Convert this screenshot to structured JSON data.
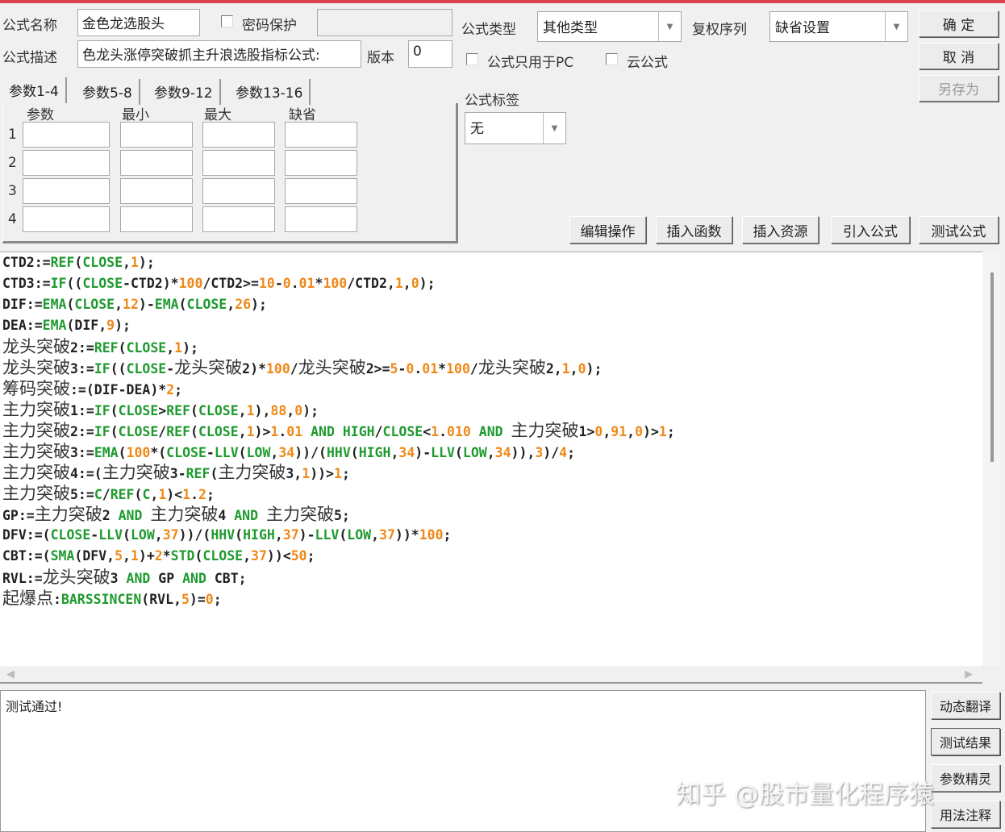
{
  "header": {
    "name_label": "公式名称",
    "name_value": "金色龙选股头",
    "password_label": "密码保护",
    "desc_label": "公式描述",
    "desc_value": "色龙头涨停突破抓主升浪选股指标公式:",
    "version_label": "版本",
    "version_value": "0",
    "type_label": "公式类型",
    "type_value": "其他类型",
    "adjust_label": "复权序列",
    "adjust_value": "缺省设置",
    "pc_only_label": "公式只用于PC",
    "cloud_label": "云公式",
    "tag_label": "公式标签",
    "tag_value": "无"
  },
  "buttons": {
    "ok": "确  定",
    "cancel": "取  消",
    "save_as": "另存为",
    "edit": "编辑操作",
    "insert_func": "插入函数",
    "insert_res": "插入资源",
    "import": "引入公式",
    "test": "测试公式"
  },
  "tabs": [
    "参数1-4",
    "参数5-8",
    "参数9-12",
    "参数13-16"
  ],
  "params": {
    "headers": [
      "参数",
      "最小",
      "最大",
      "缺省"
    ],
    "rows": [
      "1",
      "2",
      "3",
      "4"
    ]
  },
  "code": [
    [
      [
        "CTD2:=",
        "t"
      ],
      [
        "REF",
        "k"
      ],
      [
        "(",
        "t"
      ],
      [
        "CLOSE",
        "k"
      ],
      [
        ",",
        "t"
      ],
      [
        "1",
        "n"
      ],
      [
        ");",
        "t"
      ]
    ],
    [
      [
        "CTD3:=",
        "t"
      ],
      [
        "IF",
        "k"
      ],
      [
        "((",
        "t"
      ],
      [
        "CLOSE",
        "k"
      ],
      [
        "-CTD2)*",
        "t"
      ],
      [
        "100",
        "n"
      ],
      [
        "/CTD2>=",
        "t"
      ],
      [
        "10",
        "n"
      ],
      [
        "-",
        "t"
      ],
      [
        "0",
        "n"
      ],
      [
        ".",
        "t"
      ],
      [
        "01",
        "n"
      ],
      [
        "*",
        "t"
      ],
      [
        "100",
        "n"
      ],
      [
        "/CTD2,",
        "t"
      ],
      [
        "1",
        "n"
      ],
      [
        ",",
        "t"
      ],
      [
        "0",
        "n"
      ],
      [
        ");",
        "t"
      ]
    ],
    [
      [
        "DIF:=",
        "t"
      ],
      [
        "EMA",
        "k"
      ],
      [
        "(",
        "t"
      ],
      [
        "CLOSE",
        "k"
      ],
      [
        ",",
        "t"
      ],
      [
        "12",
        "n"
      ],
      [
        ")-",
        "t"
      ],
      [
        "EMA",
        "k"
      ],
      [
        "(",
        "t"
      ],
      [
        "CLOSE",
        "k"
      ],
      [
        ",",
        "t"
      ],
      [
        "26",
        "n"
      ],
      [
        ");",
        "t"
      ]
    ],
    [
      [
        "DEA:=",
        "t"
      ],
      [
        "EMA",
        "k"
      ],
      [
        "(DIF,",
        "t"
      ],
      [
        "9",
        "n"
      ],
      [
        ");",
        "t"
      ]
    ],
    [
      [
        "龙头突破",
        "c"
      ],
      [
        "2:=",
        "t"
      ],
      [
        "REF",
        "k"
      ],
      [
        "(",
        "t"
      ],
      [
        "CLOSE",
        "k"
      ],
      [
        ",",
        "t"
      ],
      [
        "1",
        "n"
      ],
      [
        ");",
        "t"
      ]
    ],
    [
      [
        "龙头突破",
        "c"
      ],
      [
        "3:=",
        "t"
      ],
      [
        "IF",
        "k"
      ],
      [
        "((",
        "t"
      ],
      [
        "CLOSE",
        "k"
      ],
      [
        "-",
        "t"
      ],
      [
        "龙头突破",
        "c"
      ],
      [
        "2)*",
        "t"
      ],
      [
        "100",
        "n"
      ],
      [
        "/",
        "t"
      ],
      [
        "龙头突破",
        "c"
      ],
      [
        "2>=",
        "t"
      ],
      [
        "5",
        "n"
      ],
      [
        "-",
        "t"
      ],
      [
        "0",
        "n"
      ],
      [
        ".",
        "t"
      ],
      [
        "01",
        "n"
      ],
      [
        "*",
        "t"
      ],
      [
        "100",
        "n"
      ],
      [
        "/",
        "t"
      ],
      [
        "龙头突破",
        "c"
      ],
      [
        "2,",
        "t"
      ],
      [
        "1",
        "n"
      ],
      [
        ",",
        "t"
      ],
      [
        "0",
        "n"
      ],
      [
        ");",
        "t"
      ]
    ],
    [
      [
        "筹码突破",
        "c"
      ],
      [
        ":=(DIF-DEA)*",
        "t"
      ],
      [
        "2",
        "n"
      ],
      [
        ";",
        "t"
      ]
    ],
    [
      [
        "主力突破",
        "c"
      ],
      [
        "1:=",
        "t"
      ],
      [
        "IF",
        "k"
      ],
      [
        "(",
        "t"
      ],
      [
        "CLOSE",
        "k"
      ],
      [
        ">",
        "t"
      ],
      [
        "REF",
        "k"
      ],
      [
        "(",
        "t"
      ],
      [
        "CLOSE",
        "k"
      ],
      [
        ",",
        "t"
      ],
      [
        "1",
        "n"
      ],
      [
        "),",
        "t"
      ],
      [
        "88",
        "n"
      ],
      [
        ",",
        "t"
      ],
      [
        "0",
        "n"
      ],
      [
        ");",
        "t"
      ]
    ],
    [
      [
        "主力突破",
        "c"
      ],
      [
        "2:=",
        "t"
      ],
      [
        "IF",
        "k"
      ],
      [
        "(",
        "t"
      ],
      [
        "CLOSE",
        "k"
      ],
      [
        "/",
        "t"
      ],
      [
        "REF",
        "k"
      ],
      [
        "(",
        "t"
      ],
      [
        "CLOSE",
        "k"
      ],
      [
        ",",
        "t"
      ],
      [
        "1",
        "n"
      ],
      [
        ")>",
        "t"
      ],
      [
        "1",
        "n"
      ],
      [
        ".",
        "t"
      ],
      [
        "01",
        "n"
      ],
      [
        " ",
        "t"
      ],
      [
        "AND",
        "k"
      ],
      [
        " ",
        "t"
      ],
      [
        "HIGH",
        "k"
      ],
      [
        "/",
        "t"
      ],
      [
        "CLOSE",
        "k"
      ],
      [
        "<",
        "t"
      ],
      [
        "1",
        "n"
      ],
      [
        ".",
        "t"
      ],
      [
        "010",
        "n"
      ],
      [
        " ",
        "t"
      ],
      [
        "AND",
        "k"
      ],
      [
        " ",
        "t"
      ],
      [
        "主力突破",
        "c"
      ],
      [
        "1>",
        "t"
      ],
      [
        "0",
        "n"
      ],
      [
        ",",
        "t"
      ],
      [
        "91",
        "n"
      ],
      [
        ",",
        "t"
      ],
      [
        "0",
        "n"
      ],
      [
        ")>",
        "t"
      ],
      [
        "1",
        "n"
      ],
      [
        ";",
        "t"
      ]
    ],
    [
      [
        "主力突破",
        "c"
      ],
      [
        "3:=",
        "t"
      ],
      [
        "EMA",
        "k"
      ],
      [
        "(",
        "t"
      ],
      [
        "100",
        "n"
      ],
      [
        "*(",
        "t"
      ],
      [
        "CLOSE",
        "k"
      ],
      [
        "-",
        "t"
      ],
      [
        "LLV",
        "k"
      ],
      [
        "(",
        "t"
      ],
      [
        "LOW",
        "k"
      ],
      [
        ",",
        "t"
      ],
      [
        "34",
        "n"
      ],
      [
        "))/(",
        "t"
      ],
      [
        "HHV",
        "k"
      ],
      [
        "(",
        "t"
      ],
      [
        "HIGH",
        "k"
      ],
      [
        ",",
        "t"
      ],
      [
        "34",
        "n"
      ],
      [
        ")-",
        "t"
      ],
      [
        "LLV",
        "k"
      ],
      [
        "(",
        "t"
      ],
      [
        "LOW",
        "k"
      ],
      [
        ",",
        "t"
      ],
      [
        "34",
        "n"
      ],
      [
        ")),",
        "t"
      ],
      [
        "3",
        "n"
      ],
      [
        ")/",
        "t"
      ],
      [
        "4",
        "n"
      ],
      [
        ";",
        "t"
      ]
    ],
    [
      [
        "主力突破",
        "c"
      ],
      [
        "4:=(",
        "t"
      ],
      [
        "主力突破",
        "c"
      ],
      [
        "3-",
        "t"
      ],
      [
        "REF",
        "k"
      ],
      [
        "(",
        "t"
      ],
      [
        "主力突破",
        "c"
      ],
      [
        "3,",
        "t"
      ],
      [
        "1",
        "n"
      ],
      [
        "))>",
        "t"
      ],
      [
        "1",
        "n"
      ],
      [
        ";",
        "t"
      ]
    ],
    [
      [
        "主力突破",
        "c"
      ],
      [
        "5:=",
        "t"
      ],
      [
        "C",
        "k"
      ],
      [
        "/",
        "t"
      ],
      [
        "REF",
        "k"
      ],
      [
        "(",
        "t"
      ],
      [
        "C",
        "k"
      ],
      [
        ",",
        "t"
      ],
      [
        "1",
        "n"
      ],
      [
        ")<",
        "t"
      ],
      [
        "1",
        "n"
      ],
      [
        ".",
        "t"
      ],
      [
        "2",
        "n"
      ],
      [
        ";",
        "t"
      ]
    ],
    [
      [
        "GP:=",
        "t"
      ],
      [
        "主力突破",
        "c"
      ],
      [
        "2 ",
        "t"
      ],
      [
        "AND",
        "k"
      ],
      [
        " ",
        "t"
      ],
      [
        "主力突破",
        "c"
      ],
      [
        "4 ",
        "t"
      ],
      [
        "AND",
        "k"
      ],
      [
        " ",
        "t"
      ],
      [
        "主力突破",
        "c"
      ],
      [
        "5;",
        "t"
      ]
    ],
    [
      [
        "DFV:=(",
        "t"
      ],
      [
        "CLOSE",
        "k"
      ],
      [
        "-",
        "t"
      ],
      [
        "LLV",
        "k"
      ],
      [
        "(",
        "t"
      ],
      [
        "LOW",
        "k"
      ],
      [
        ",",
        "t"
      ],
      [
        "37",
        "n"
      ],
      [
        "))/(",
        "t"
      ],
      [
        "HHV",
        "k"
      ],
      [
        "(",
        "t"
      ],
      [
        "HIGH",
        "k"
      ],
      [
        ",",
        "t"
      ],
      [
        "37",
        "n"
      ],
      [
        ")-",
        "t"
      ],
      [
        "LLV",
        "k"
      ],
      [
        "(",
        "t"
      ],
      [
        "LOW",
        "k"
      ],
      [
        ",",
        "t"
      ],
      [
        "37",
        "n"
      ],
      [
        "))*",
        "t"
      ],
      [
        "100",
        "n"
      ],
      [
        ";",
        "t"
      ]
    ],
    [
      [
        "CBT:=(",
        "t"
      ],
      [
        "SMA",
        "k"
      ],
      [
        "(DFV,",
        "t"
      ],
      [
        "5",
        "n"
      ],
      [
        ",",
        "t"
      ],
      [
        "1",
        "n"
      ],
      [
        ")+",
        "t"
      ],
      [
        "2",
        "n"
      ],
      [
        "*",
        "t"
      ],
      [
        "STD",
        "k"
      ],
      [
        "(",
        "t"
      ],
      [
        "CLOSE",
        "k"
      ],
      [
        ",",
        "t"
      ],
      [
        "37",
        "n"
      ],
      [
        "))<",
        "t"
      ],
      [
        "50",
        "n"
      ],
      [
        ";",
        "t"
      ]
    ],
    [
      [
        "RVL:=",
        "t"
      ],
      [
        "龙头突破",
        "c"
      ],
      [
        "3 ",
        "t"
      ],
      [
        "AND",
        "k"
      ],
      [
        " GP ",
        "t"
      ],
      [
        "AND",
        "k"
      ],
      [
        " CBT;",
        "t"
      ]
    ],
    [
      [
        "起爆点",
        "c"
      ],
      [
        ":",
        "t"
      ],
      [
        "BARSSINCEN",
        "k"
      ],
      [
        "(RVL,",
        "t"
      ],
      [
        "5",
        "n"
      ],
      [
        ")=",
        "t"
      ],
      [
        "0",
        "n"
      ],
      [
        ";",
        "t"
      ]
    ]
  ],
  "result_text": "测试通过!",
  "side_buttons": [
    "动态翻译",
    "测试结果",
    "参数精灵",
    "用法注释"
  ],
  "watermark": "知乎 @股市量化程序猿",
  "colors": {
    "keyword": "#1e9a2e",
    "number": "#f08818",
    "title_bar": "#d9434a"
  }
}
